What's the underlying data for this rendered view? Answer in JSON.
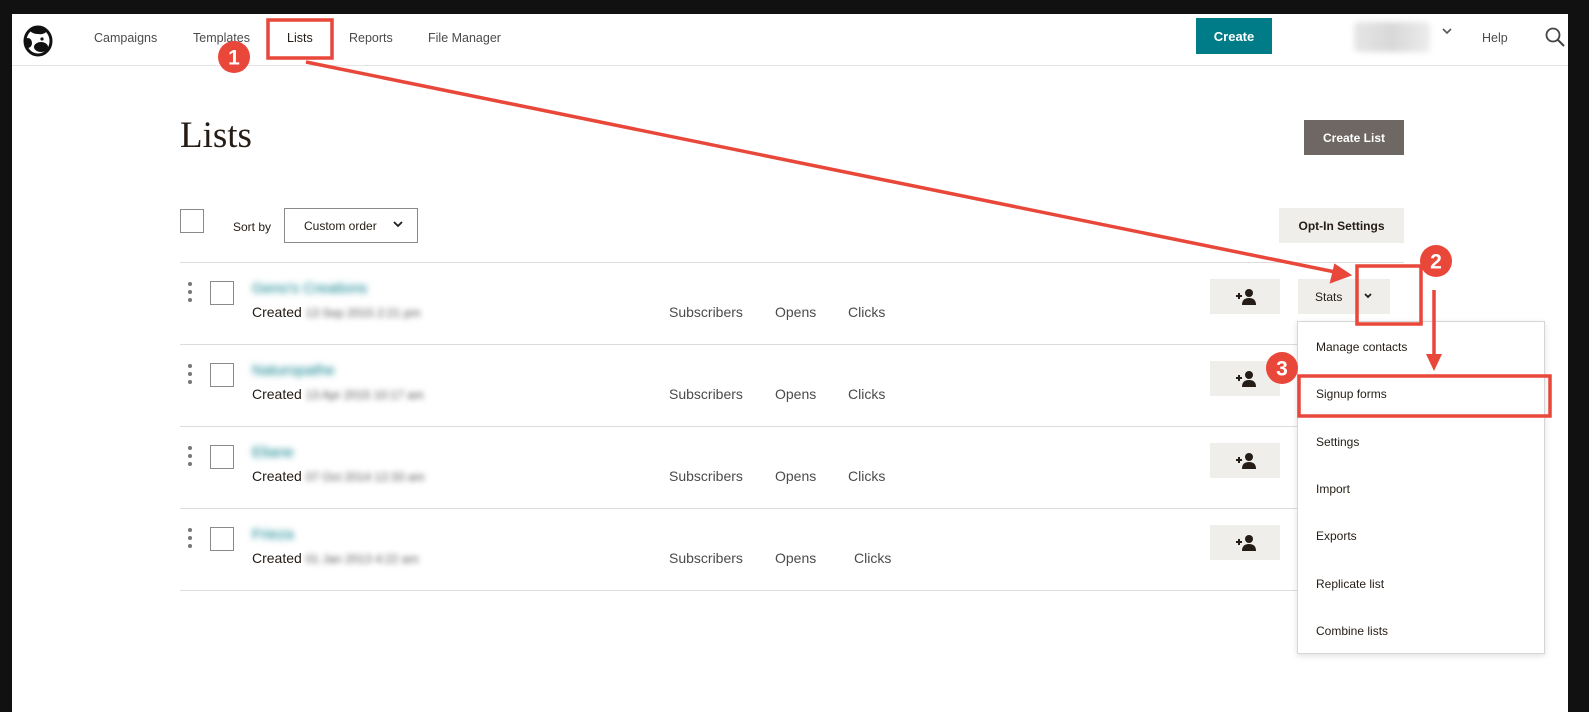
{
  "nav": {
    "links": [
      "Campaigns",
      "Templates",
      "Lists",
      "Reports",
      "File Manager"
    ],
    "create_label": "Create",
    "help_label": "Help"
  },
  "page": {
    "title": "Lists",
    "create_list_label": "Create List",
    "sort_label": "Sort by",
    "sort_value": "Custom order",
    "optin_label": "Opt-In Settings"
  },
  "rows": [
    {
      "name": "Geno's Creations",
      "created_label": "Created",
      "created_date": "13 Sep 2015 2:21 pm",
      "subscribers": "Subscribers",
      "opens": "Opens",
      "clicks": "Clicks",
      "stats": "Stats"
    },
    {
      "name": "Naturopathe",
      "created_label": "Created",
      "created_date": "13 Apr 2015 10:17 am",
      "subscribers": "Subscribers",
      "opens": "Opens",
      "clicks": "Clicks"
    },
    {
      "name": "Eliane",
      "created_label": "Created",
      "created_date": "07 Oct 2014 12:33 am",
      "subscribers": "Subscribers",
      "opens": "Opens",
      "clicks": "Clicks"
    },
    {
      "name": "Frieza",
      "created_label": "Created",
      "created_date": "01 Jan 2013 4:22 am",
      "subscribers": "Subscribers",
      "opens": "Opens",
      "clicks": "Clicks"
    }
  ],
  "dropdown": {
    "items": [
      "Manage contacts",
      "Signup forms",
      "Settings",
      "Import",
      "Exports",
      "Replicate list",
      "Combine lists"
    ]
  },
  "annotations": {
    "color": "#e8473a",
    "steps": [
      "1",
      "2",
      "3"
    ]
  },
  "colors": {
    "accent": "#007c89",
    "create_list_bg": "#6e6763",
    "button_bg": "#efeeea"
  }
}
